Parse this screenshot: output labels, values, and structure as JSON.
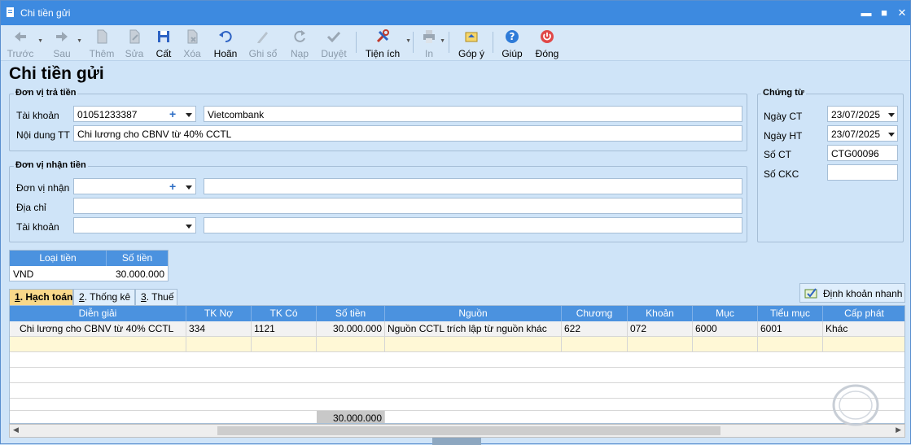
{
  "window": {
    "title": "Chi tiền gửi",
    "controls": {
      "minimize": "▬",
      "maximize": "■",
      "close": "✕"
    }
  },
  "toolbar": {
    "prev": "Trước",
    "next": "Sau",
    "add": "Thêm",
    "edit": "Sửa",
    "save": "Cất",
    "delete": "Xóa",
    "undo": "Hoãn",
    "post": "Ghi sổ",
    "reload": "Nạp",
    "approve": "Duyệt",
    "utilities": "Tiện ích",
    "print": "In",
    "feedback": "Góp ý",
    "help": "Giúp",
    "close": "Đóng"
  },
  "page": {
    "title": "Chi tiền gửi"
  },
  "payer": {
    "group_title": "Đơn vị trả tiền",
    "account_label": "Tài khoản",
    "account_value": "01051233387",
    "bank_name": "Vietcombank",
    "content_label": "Nội dung TT",
    "content_value": "Chi lương cho CBNV từ 40% CCTL"
  },
  "payee": {
    "group_title": "Đơn vị nhận tiền",
    "unit_label": "Đơn vị nhận",
    "unit_value": "",
    "unit_name": "",
    "address_label": "Địa chỉ",
    "address_value": "",
    "account_label": "Tài khoản",
    "account_value": "",
    "account_name": ""
  },
  "voucher": {
    "group_title": "Chứng từ",
    "date_ct_label": "Ngày CT",
    "date_ct": "23/07/2025",
    "date_ht_label": "Ngày HT",
    "date_ht": "23/07/2025",
    "so_ct_label": "Số CT",
    "so_ct": "CTG00096",
    "so_ckc_label": "Số CKC",
    "so_ckc": ""
  },
  "currency": {
    "type_header": "Loại tiền",
    "amount_header": "Số tiền",
    "type": "VND",
    "amount": "30.000.000"
  },
  "tabs": [
    {
      "key": "1",
      "label": ". Hạch toán"
    },
    {
      "key": "2",
      "label": ". Thống kê"
    },
    {
      "key": "3",
      "label": ". Thuế"
    }
  ],
  "quick_entry": "Định khoản nhanh",
  "grid": {
    "headers": [
      "Diễn giải",
      "TK Nợ",
      "TK Có",
      "Số tiền",
      "Nguồn",
      "Chương",
      "Khoản",
      "Mục",
      "Tiểu mục",
      "Cấp phát"
    ],
    "rows": [
      [
        "Chi lương cho CBNV từ 40% CCTL",
        "334",
        "1121",
        "30.000.000",
        "Nguồn CCTL trích lập từ nguồn khác",
        "622",
        "072",
        "6000",
        "6001",
        "Khác"
      ]
    ],
    "total_amount": "30.000.000"
  },
  "colors": {
    "titlebar": "#3d8ae0",
    "grid_header": "#4b92df",
    "active_tab": "#f8d88a",
    "background": "#cfe4f8"
  }
}
